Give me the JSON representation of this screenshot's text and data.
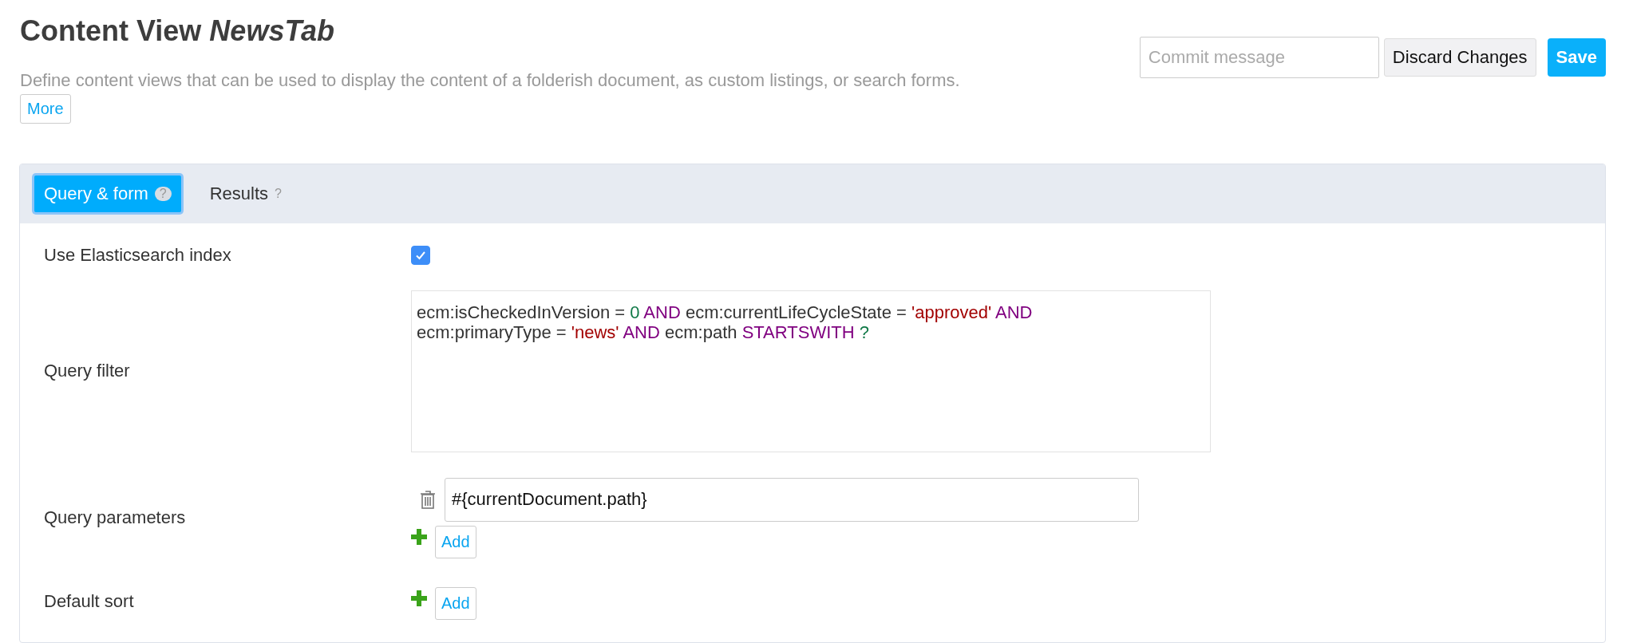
{
  "header": {
    "title": "Content View",
    "title_name": "NewsTab",
    "description": "Define content views that can be used to display the content of a folderish document, as custom listings, or search forms.",
    "more_link": "More"
  },
  "actions": {
    "commit": {
      "placeholder": "Commit message"
    },
    "discard": "Discard Changes",
    "save": "Save"
  },
  "tabs": [
    {
      "label": "Query & form",
      "help": "?",
      "selected": true
    },
    {
      "label": "Results",
      "help": "?",
      "selected": false
    }
  ],
  "form": {
    "elasticsearch": {
      "label": "Use Elasticsearch index",
      "checked": true
    },
    "query_filter": {
      "label": "Query filter",
      "lines": [
        [
          {
            "kind": "plain",
            "text": "ecm:isCheckedInVersion = "
          },
          {
            "kind": "number",
            "text": "0"
          },
          {
            "kind": "keyword",
            "text": " AND "
          },
          {
            "kind": "plain",
            "text": "ecm:currentLifeCycleState = "
          },
          {
            "kind": "string",
            "text": "'approved'"
          },
          {
            "kind": "keyword",
            "text": " AND"
          }
        ],
        [
          {
            "kind": "plain",
            "text": "ecm:primaryType = "
          },
          {
            "kind": "string",
            "text": "'news'"
          },
          {
            "kind": "keyword",
            "text": " AND "
          },
          {
            "kind": "plain",
            "text": "ecm:path "
          },
          {
            "kind": "keyword",
            "text": "STARTSWITH "
          },
          {
            "kind": "number",
            "text": "?"
          }
        ]
      ]
    },
    "query_parameters": {
      "label": "Query parameters",
      "values": [
        "#{currentDocument.path}"
      ],
      "add": "Add"
    },
    "default_sort": {
      "label": "Default sort",
      "add": "Add"
    }
  }
}
